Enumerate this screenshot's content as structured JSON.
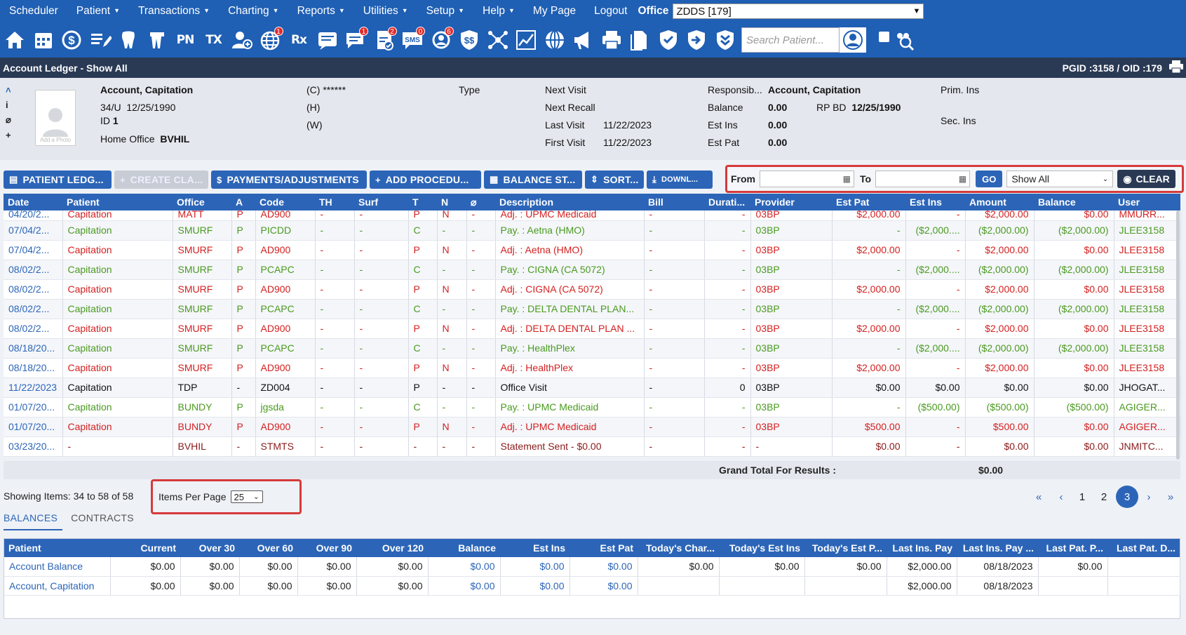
{
  "menu": {
    "items": [
      {
        "label": "Scheduler",
        "caret": false
      },
      {
        "label": "Patient",
        "caret": true
      },
      {
        "label": "Transactions",
        "caret": true
      },
      {
        "label": "Charting",
        "caret": true
      },
      {
        "label": "Reports",
        "caret": true
      },
      {
        "label": "Utilities",
        "caret": true
      },
      {
        "label": "Setup",
        "caret": true
      },
      {
        "label": "Help",
        "caret": true
      },
      {
        "label": "My Page",
        "caret": false
      },
      {
        "label": "Logout",
        "caret": false
      }
    ],
    "office_label": "Office",
    "office_value": "ZDDS [179]"
  },
  "toolbar": {
    "icons": [
      {
        "name": "home-icon"
      },
      {
        "name": "calendar-icon"
      },
      {
        "name": "dollar-icon"
      },
      {
        "name": "edit-list-icon"
      },
      {
        "name": "tooth-icon"
      },
      {
        "name": "tooth-roots-icon"
      },
      {
        "name": "pn-icon",
        "text": "PN"
      },
      {
        "name": "tx-icon",
        "text": "TX"
      },
      {
        "name": "add-user-icon"
      },
      {
        "name": "globe-icon",
        "badge": "1"
      },
      {
        "name": "rx-icon",
        "text": "Rx"
      },
      {
        "name": "message-icon"
      },
      {
        "name": "chat-icon",
        "badge": "1"
      },
      {
        "name": "document-check-icon",
        "badge": "2"
      },
      {
        "name": "sms-icon",
        "badge": "0",
        "text": "SMS"
      },
      {
        "name": "support-icon",
        "badge": "6"
      },
      {
        "name": "shield-dollar-icon"
      },
      {
        "name": "network-icon"
      },
      {
        "name": "chart-line-icon"
      },
      {
        "name": "web-icon"
      },
      {
        "name": "megaphone-icon"
      },
      {
        "name": "printer-icon"
      },
      {
        "name": "files-icon"
      },
      {
        "name": "shield-check-icon"
      },
      {
        "name": "shield-arrow-icon"
      },
      {
        "name": "shield-chevrons-icon"
      }
    ],
    "search_placeholder": "Search Patient..."
  },
  "title": {
    "text": "Account Ledger - Show All",
    "pgid": "PGID :3158  /  OID :179"
  },
  "patient": {
    "photo_caption": "Add a Photo",
    "name": "Account, Capitation",
    "age_sex": "34/U",
    "dob": "12/25/1990",
    "id_label": "ID",
    "id": "1",
    "home_office_label": "Home Office",
    "home_office": "BVHIL",
    "phone_c": "(C) ******",
    "phone_h": "(H)",
    "phone_w": "(W)",
    "type_label": "Type",
    "next_visit_label": "Next Visit",
    "next_recall_label": "Next Recall",
    "last_visit_label": "Last Visit",
    "last_visit": "11/22/2023",
    "first_visit_label": "First Visit",
    "first_visit": "11/22/2023",
    "responsible_label": "Responsib...",
    "responsible": "Account, Capitation",
    "balance_label": "Balance",
    "balance": "0.00",
    "rp_bd_label": "RP BD",
    "rp_bd": "12/25/1990",
    "est_ins_label": "Est Ins",
    "est_ins": "0.00",
    "est_pat_label": "Est Pat",
    "est_pat": "0.00",
    "prim_ins_label": "Prim. Ins",
    "sec_ins_label": "Sec. Ins"
  },
  "actions": {
    "patient_ledger": "PATIENT LEDG...",
    "create_claim": "CREATE CLA...",
    "payments": "PAYMENTS/ADJUSTMENTS",
    "add_procedure": "ADD PROCEDU...",
    "balance_statement": "BALANCE ST...",
    "sort": "SORT...",
    "download": "DOWNL..."
  },
  "filter": {
    "from_label": "From",
    "to_label": "To",
    "go": "GO",
    "show_value": "Show All",
    "clear": "CLEAR"
  },
  "ledger": {
    "columns": [
      "Date",
      "Patient",
      "Office",
      "A",
      "Code",
      "TH",
      "Surf",
      "T",
      "N",
      "",
      "Description",
      "Bill",
      "Durati...",
      "Provider",
      "Est Pat",
      "Est Ins",
      "Amount",
      "Balance",
      "User"
    ],
    "rows": [
      {
        "tone": "r",
        "cells": [
          "04/20/2...",
          "Capitation",
          "MATT",
          "P",
          "AD900",
          "-",
          "-",
          "P",
          "N",
          "-",
          "Adj. : UPMC Medicaid",
          "-",
          "-",
          "03BP",
          "$2,000.00",
          "-",
          "$2,000.00",
          "$0.00",
          "MMURR..."
        ]
      },
      {
        "tone": "g",
        "cells": [
          "07/04/2...",
          "Capitation",
          "SMURF",
          "P",
          "PICDD",
          "-",
          "-",
          "C",
          "-",
          "-",
          "Pay. : Aetna (HMO)",
          "-",
          "-",
          "03BP",
          "-",
          "($2,000....",
          "($2,000.00)",
          "($2,000.00)",
          "JLEE3158"
        ]
      },
      {
        "tone": "r",
        "cells": [
          "07/04/2...",
          "Capitation",
          "SMURF",
          "P",
          "AD900",
          "-",
          "-",
          "P",
          "N",
          "-",
          "Adj. : Aetna (HMO)",
          "-",
          "-",
          "03BP",
          "$2,000.00",
          "-",
          "$2,000.00",
          "$0.00",
          "JLEE3158"
        ]
      },
      {
        "tone": "g",
        "cells": [
          "08/02/2...",
          "Capitation",
          "SMURF",
          "P",
          "PCAPC",
          "-",
          "-",
          "C",
          "-",
          "-",
          "Pay. : CIGNA (CA 5072)",
          "-",
          "-",
          "03BP",
          "-",
          "($2,000....",
          "($2,000.00)",
          "($2,000.00)",
          "JLEE3158"
        ]
      },
      {
        "tone": "r",
        "cells": [
          "08/02/2...",
          "Capitation",
          "SMURF",
          "P",
          "AD900",
          "-",
          "-",
          "P",
          "N",
          "-",
          "Adj. : CIGNA (CA 5072)",
          "-",
          "-",
          "03BP",
          "$2,000.00",
          "-",
          "$2,000.00",
          "$0.00",
          "JLEE3158"
        ]
      },
      {
        "tone": "g",
        "cells": [
          "08/02/2...",
          "Capitation",
          "SMURF",
          "P",
          "PCAPC",
          "-",
          "-",
          "C",
          "-",
          "-",
          "Pay. : DELTA DENTAL PLAN...",
          "-",
          "-",
          "03BP",
          "-",
          "($2,000....",
          "($2,000.00)",
          "($2,000.00)",
          "JLEE3158"
        ]
      },
      {
        "tone": "r",
        "cells": [
          "08/02/2...",
          "Capitation",
          "SMURF",
          "P",
          "AD900",
          "-",
          "-",
          "P",
          "N",
          "-",
          "Adj. : DELTA DENTAL PLAN ...",
          "-",
          "-",
          "03BP",
          "$2,000.00",
          "-",
          "$2,000.00",
          "$0.00",
          "JLEE3158"
        ]
      },
      {
        "tone": "g",
        "cells": [
          "08/18/20...",
          "Capitation",
          "SMURF",
          "P",
          "PCAPC",
          "-",
          "-",
          "C",
          "-",
          "-",
          "Pay. : HealthPlex",
          "-",
          "-",
          "03BP",
          "-",
          "($2,000....",
          "($2,000.00)",
          "($2,000.00)",
          "JLEE3158"
        ]
      },
      {
        "tone": "r",
        "cells": [
          "08/18/20...",
          "Capitation",
          "SMURF",
          "P",
          "AD900",
          "-",
          "-",
          "P",
          "N",
          "-",
          "Adj. : HealthPlex",
          "-",
          "-",
          "03BP",
          "$2,000.00",
          "-",
          "$2,000.00",
          "$0.00",
          "JLEE3158"
        ]
      },
      {
        "tone": "k",
        "cells": [
          "11/22/2023",
          "Capitation",
          "TDP",
          "-",
          "ZD004",
          "-",
          "-",
          "P",
          "-",
          "-",
          "Office Visit",
          "-",
          "0",
          "03BP",
          "$0.00",
          "$0.00",
          "$0.00",
          "$0.00",
          "JHOGAT..."
        ]
      },
      {
        "tone": "g",
        "cells": [
          "01/07/20...",
          "Capitation",
          "BUNDY",
          "P",
          "jgsda",
          "-",
          "-",
          "C",
          "-",
          "-",
          "Pay. : UPMC Medicaid",
          "-",
          "-",
          "03BP",
          "-",
          "($500.00)",
          "($500.00)",
          "($500.00)",
          "AGIGER..."
        ]
      },
      {
        "tone": "r",
        "cells": [
          "01/07/20...",
          "Capitation",
          "BUNDY",
          "P",
          "AD900",
          "-",
          "-",
          "P",
          "N",
          "-",
          "Adj. : UPMC Medicaid",
          "-",
          "-",
          "03BP",
          "$500.00",
          "-",
          "$500.00",
          "$0.00",
          "AGIGER..."
        ]
      },
      {
        "tone": "m",
        "cells": [
          "03/23/20...",
          "-",
          "BVHIL",
          "-",
          "STMTS",
          "-",
          "-",
          "-",
          "-",
          "-",
          "Statement Sent - $0.00",
          "-",
          "-",
          "-",
          "$0.00",
          "-",
          "$0.00",
          "$0.00",
          "JNMITC..."
        ]
      }
    ],
    "grand_total_label": "Grand Total For Results :",
    "grand_total": "$0.00"
  },
  "pager": {
    "showing": "Showing Items: 34 to 58 of 58",
    "items_per_page_label": "Items Per Page",
    "items_per_page": "25",
    "first": "«",
    "prev": "‹",
    "pages": [
      "1",
      "2",
      "3"
    ],
    "current_page": "3",
    "next": "›",
    "last": "»"
  },
  "tabs": [
    "BALANCES",
    "CONTRACTS"
  ],
  "balances": {
    "columns": [
      "Patient",
      "Current",
      "Over 30",
      "Over 60",
      "Over 90",
      "Over 120",
      "Balance",
      "Est Ins",
      "Est Pat",
      "Today's Char...",
      "Today's Est Ins",
      "Today's Est P...",
      "Last Ins. Pay",
      "Last Ins. Pay ...",
      "Last Pat. P...",
      "Last Pat. D..."
    ],
    "rows": [
      [
        "Account Balance",
        "$0.00",
        "$0.00",
        "$0.00",
        "$0.00",
        "$0.00",
        "$0.00",
        "$0.00",
        "$0.00",
        "$0.00",
        "$0.00",
        "$0.00",
        "$2,000.00",
        "08/18/2023",
        "$0.00",
        ""
      ],
      [
        "Account, Capitation",
        "$0.00",
        "$0.00",
        "$0.00",
        "$0.00",
        "$0.00",
        "$0.00",
        "$0.00",
        "$0.00",
        "",
        "",
        "",
        "$2,000.00",
        "08/18/2023",
        "",
        ""
      ]
    ]
  },
  "colors": {
    "menu_bg": "#1f5fb4",
    "title_bg": "#2a3a55",
    "adj_red": "#d42020",
    "pay_green": "#4a9a1f",
    "highlight": "#d63a3a"
  }
}
